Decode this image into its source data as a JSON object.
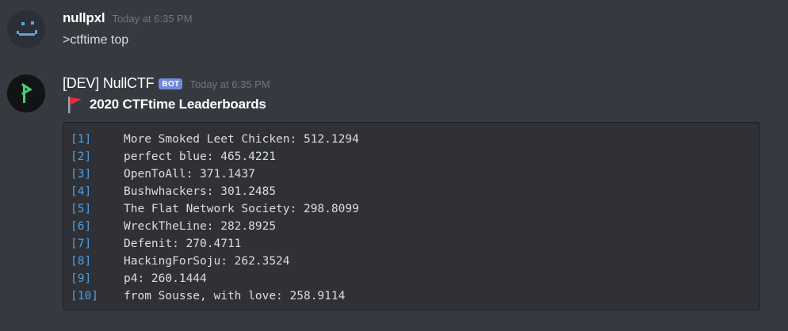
{
  "messages": [
    {
      "username": "nullpxl",
      "timestamp": "Today at 6:35 PM",
      "content": ">ctftime top"
    },
    {
      "username": "[DEV] NullCTF",
      "bot_tag": "BOT",
      "timestamp": "Today at 6:35 PM",
      "embed": {
        "title": "2020 CTFtime Leaderboards",
        "rows": [
          {
            "rank": "[1]",
            "text": "More Smoked Leet Chicken: 512.1294"
          },
          {
            "rank": "[2]",
            "text": "perfect blue: 465.4221"
          },
          {
            "rank": "[3]",
            "text": "OpenToAll: 371.1437"
          },
          {
            "rank": "[4]",
            "text": "Bushwhackers: 301.2485"
          },
          {
            "rank": "[5]",
            "text": "The Flat Network Society: 298.8099"
          },
          {
            "rank": "[6]",
            "text": "WreckTheLine: 282.8925"
          },
          {
            "rank": "[7]",
            "text": "Defenit: 270.4711"
          },
          {
            "rank": "[8]",
            "text": "HackingForSoju: 262.3524"
          },
          {
            "rank": "[9]",
            "text": "p4: 260.1444"
          },
          {
            "rank": "[10]",
            "text": "from Sousse, with love: 258.9114"
          }
        ]
      }
    }
  ],
  "colors": {
    "background": "#36393f",
    "code_background": "#2f3136",
    "rank_blue": "#4e9fe5",
    "bot_tag": "#7289da",
    "timestamp": "#72767d",
    "flag_red": "#dd2e44"
  },
  "icons": {
    "user_avatar": "smiley-face-icon",
    "bot_avatar": "prompt-flag-icon",
    "title_icon": "triangular-flag-icon"
  }
}
